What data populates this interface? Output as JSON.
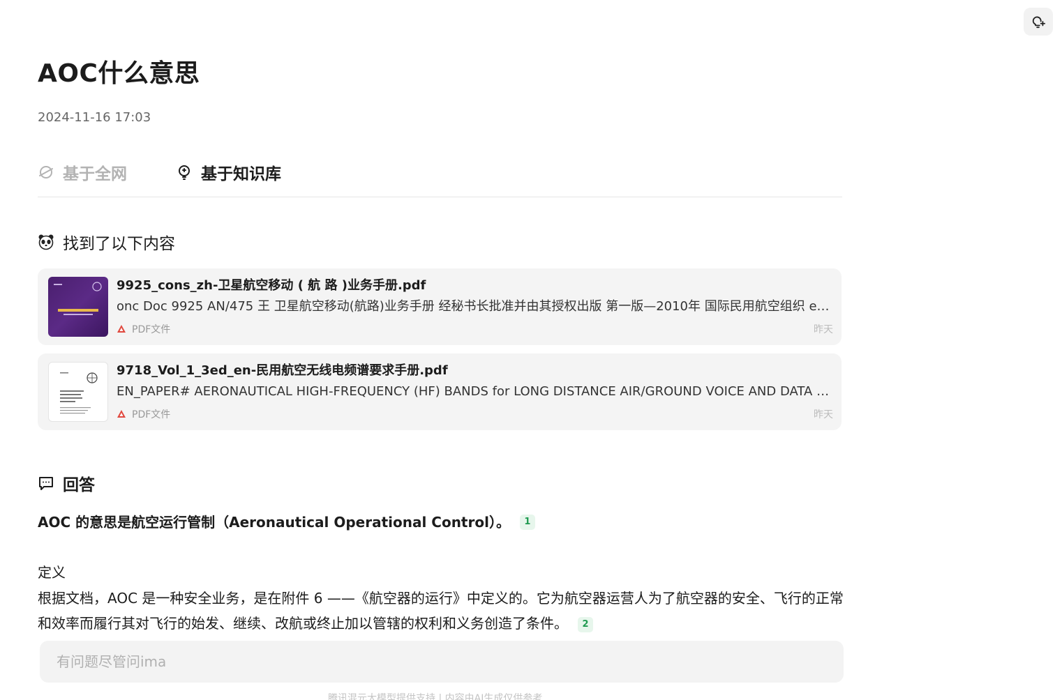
{
  "page": {
    "title": "AOC什么意思",
    "timestamp": "2024-11-16 17:03"
  },
  "tabs": [
    {
      "label": "基于全网",
      "icon": "planet-icon",
      "active": false
    },
    {
      "label": "基于知识库",
      "icon": "bulb-icon",
      "active": true
    }
  ],
  "results": {
    "heading": "找到了以下内容",
    "icon": "panda-icon",
    "items": [
      {
        "title": "9925_cons_zh-卫星航空移动 ( 航 路 )业务手册.pdf",
        "snippet": "onc Doc 9925 AN/475 王 卫星航空移动(航路)业务手册 经秘书长批准并由其授权出版 第一版—2010年 国际民用航空组织 eio...",
        "type_label": "PDF文件",
        "date": "昨天",
        "thumb": "purple-cover"
      },
      {
        "title": "9718_Vol_1_3ed_en-民用航空无线电频谱要求手册.pdf",
        "snippet": "EN_PAPER# AERONAUTICAL HIGH-FREQUENCY (HF) BANDS for LONG DISTANCE AIR/GROUND VOICE AND DATA CO...",
        "type_label": "PDF文件",
        "date": "昨天",
        "thumb": "white-cover"
      }
    ]
  },
  "answer": {
    "heading": "回答",
    "icon": "chat-icon",
    "lead": "AOC 的意思是航空运行管制（Aeronautical Operational Control）。",
    "lead_cite": "1",
    "def_label": "定义",
    "def_body": "根据文档，AOC 是一种安全业务，是在附件 6 ——《航空器的运行》中定义的。它为航空器运营人为了航空器的安全、飞行的正常和效率而履行其对飞行的始发、继续、改航或终止加以管辖的权利和义务创造了条件。",
    "def_cite": "2"
  },
  "ask": {
    "placeholder": "有问题尽管问ima"
  },
  "footer": {
    "note": "腾讯混元大模型提供支持 | 内容由AI生成仅供参考"
  },
  "colors": {
    "accent_green": "#1f9a50",
    "pdf_red": "#e0483e",
    "thumb_purple": "#4a1f6e"
  }
}
